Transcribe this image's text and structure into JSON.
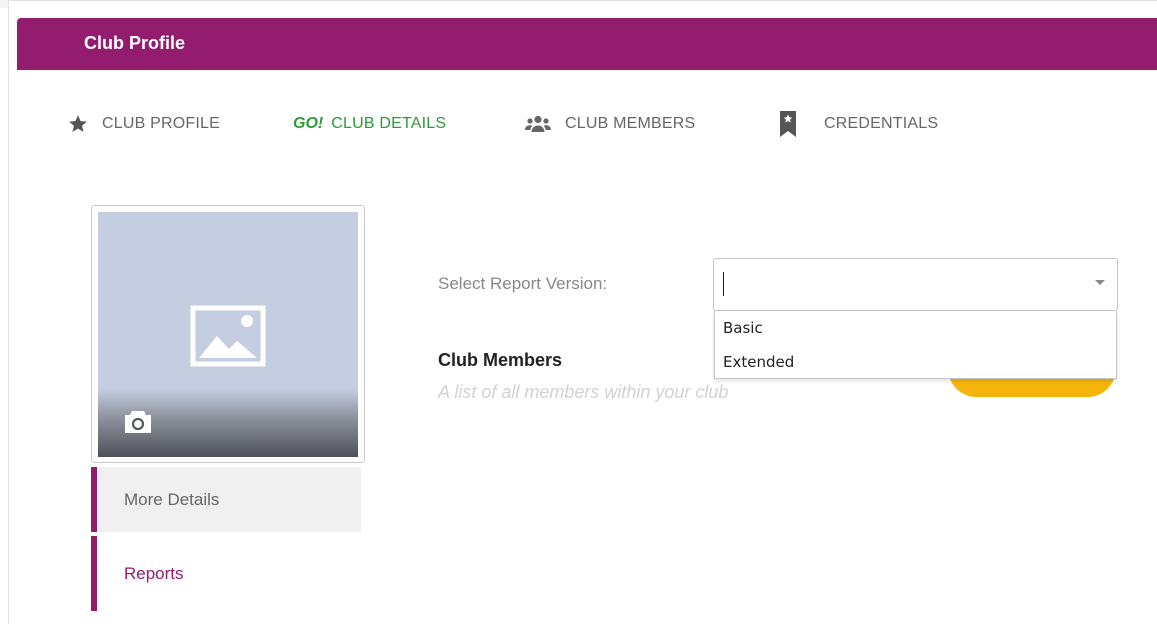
{
  "header": {
    "title": "Club Profile"
  },
  "tabs": [
    {
      "label": "CLUB PROFILE",
      "icon": "star-icon"
    },
    {
      "label": "CLUB DETAILS",
      "badge": "GO!"
    },
    {
      "label": "CLUB MEMBERS",
      "icon": "users-icon"
    },
    {
      "label": "CREDENTIALS",
      "icon": "bookmark-star-icon"
    }
  ],
  "sidebar": {
    "items": [
      {
        "label": "More Details"
      },
      {
        "label": "Reports"
      }
    ]
  },
  "report": {
    "label": "Select Report Version:",
    "value": "",
    "options": [
      "Basic",
      "Extended"
    ]
  },
  "section": {
    "title": "Club Members",
    "subtitle": "A list of all members within your club"
  },
  "colors": {
    "brand": "#941c6f",
    "go_green": "#2d9a3a",
    "accent_yellow": "#f5b40a"
  }
}
